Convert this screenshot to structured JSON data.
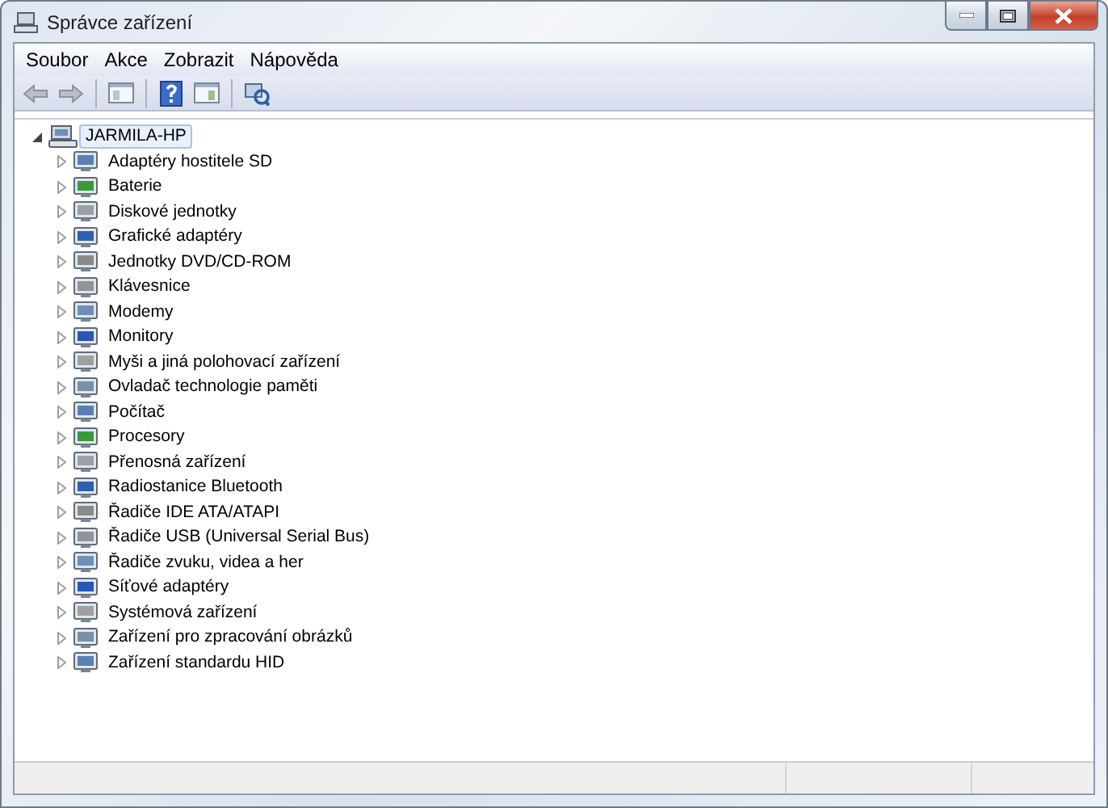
{
  "window": {
    "title": "Správce zařízení"
  },
  "menu": [
    "Soubor",
    "Akce",
    "Zobrazit",
    "Nápověda"
  ],
  "tree": {
    "label": "JARMILA-HP",
    "expanded": true,
    "selected": true,
    "children": [
      {
        "label": "Adaptéry hostitele SD",
        "expanded": false
      },
      {
        "label": "Baterie",
        "expanded": false
      },
      {
        "label": "Diskové jednotky",
        "expanded": false
      },
      {
        "label": "Grafické adaptéry",
        "expanded": false
      },
      {
        "label": "Jednotky DVD/CD-ROM",
        "expanded": false
      },
      {
        "label": "Klávesnice",
        "expanded": false
      },
      {
        "label": "Modemy",
        "expanded": false
      },
      {
        "label": "Monitory",
        "expanded": false
      },
      {
        "label": "Myši a jiná polohovací zařízení",
        "expanded": false
      },
      {
        "label": "Ovladač technologie paměti",
        "expanded": false
      },
      {
        "label": "Počítač",
        "expanded": false
      },
      {
        "label": "Procesory",
        "expanded": false
      },
      {
        "label": "Přenosná zařízení",
        "expanded": false
      },
      {
        "label": "Radiostanice Bluetooth",
        "expanded": false
      },
      {
        "label": "Řadiče IDE ATA/ATAPI",
        "expanded": false
      },
      {
        "label": "Řadiče USB (Universal Serial Bus)",
        "expanded": false
      },
      {
        "label": "Řadiče zvuku, videa a her",
        "expanded": false
      },
      {
        "label": "Síťové adaptéry",
        "expanded": false
      },
      {
        "label": "Systémová zařízení",
        "expanded": false
      },
      {
        "label": "Zařízení pro zpracování obrázků",
        "expanded": false
      },
      {
        "label": "Zařízení standardu HID",
        "expanded": false
      }
    ]
  }
}
